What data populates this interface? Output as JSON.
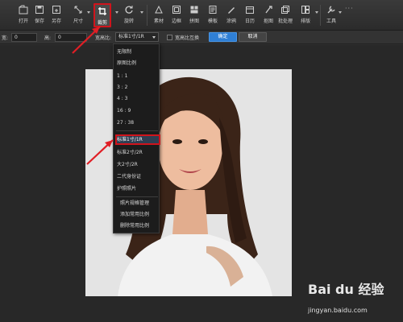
{
  "toolbar": {
    "items": [
      {
        "label": "打开",
        "icon": "open-icon"
      },
      {
        "label": "保存",
        "icon": "save-icon"
      },
      {
        "label": "另存",
        "icon": "save-as-icon"
      },
      {
        "label": "尺寸",
        "icon": "resize-icon"
      },
      {
        "label": "裁剪",
        "icon": "crop-icon"
      },
      {
        "label": "旋转",
        "icon": "rotate-icon"
      },
      {
        "label": "素材",
        "icon": "material-icon"
      },
      {
        "label": "边框",
        "icon": "border-icon"
      },
      {
        "label": "拼图",
        "icon": "collage-icon"
      },
      {
        "label": "模板",
        "icon": "template-icon"
      },
      {
        "label": "涂鸦",
        "icon": "doodle-icon"
      },
      {
        "label": "日历",
        "icon": "calendar-icon"
      },
      {
        "label": "抠图",
        "icon": "cutout-icon"
      },
      {
        "label": "批处理",
        "icon": "batch-icon"
      },
      {
        "label": "排版",
        "icon": "layout-icon"
      },
      {
        "label": "工具",
        "icon": "tools-icon"
      }
    ]
  },
  "optionbar": {
    "width_label": "宽:",
    "width_value": "0",
    "height_label": "高:",
    "height_value": "0",
    "ratio_label": "宽高比:",
    "ratio_selected": "标准1寸/1R",
    "swap_label": "宽高比互换",
    "ok_label": "确定",
    "cancel_label": "取消"
  },
  "dropdown": {
    "group1": [
      "无限制",
      "原图比例",
      "1 : 1",
      "3 : 2",
      "4 : 3",
      "16 : 9",
      "27 : 38"
    ],
    "group2": [
      "标准1寸/1R",
      "标准2寸/2R",
      "大2寸/2R",
      "二代身份证",
      "护照照片"
    ],
    "group3": [
      "照片规格管理",
      "添加常用比例",
      "删除常用比例"
    ]
  },
  "watermark": {
    "brand": "Bai du 经验",
    "url": "jingyan.baidu.com"
  },
  "colors": {
    "accent_blue": "#2f7fd5",
    "highlight_red": "#d0141c",
    "toolbar_bg": "#2b2b2b"
  }
}
